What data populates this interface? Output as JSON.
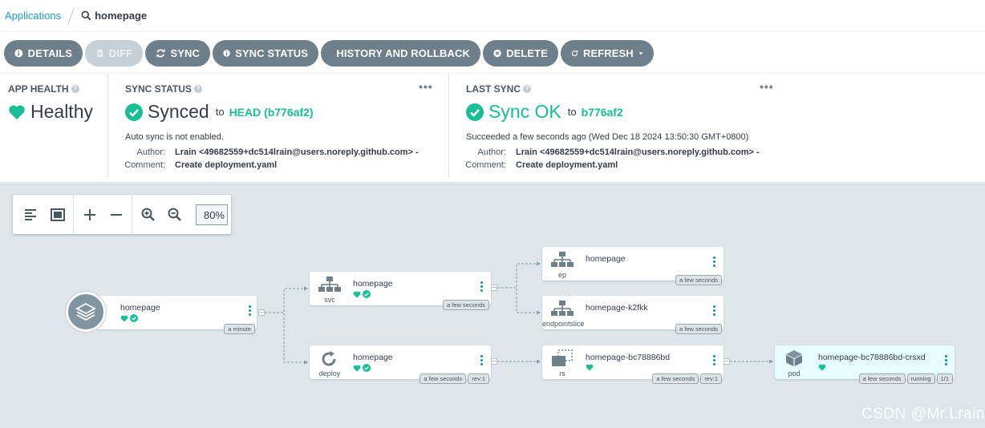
{
  "breadcrumb": {
    "root": "Applications",
    "current": "homepage"
  },
  "toolbar": {
    "details": "DETAILS",
    "diff": "DIFF",
    "sync": "SYNC",
    "sync_status": "SYNC STATUS",
    "history": "HISTORY AND ROLLBACK",
    "delete": "DELETE",
    "refresh": "REFRESH"
  },
  "app_health": {
    "title": "APP HEALTH",
    "value": "Healthy"
  },
  "sync_status": {
    "title": "SYNC STATUS",
    "value": "Synced",
    "to_label": "to",
    "revision": "HEAD (b776af2)",
    "note": "Auto sync is not enabled.",
    "author_label": "Author:",
    "author": "Lrain <49682559+dc514lrain@users.noreply.github.com> -",
    "comment_label": "Comment:",
    "comment": "Create deployment.yaml"
  },
  "last_sync": {
    "title": "LAST SYNC",
    "value": "Sync OK",
    "to_label": "to",
    "revision": "b776af2",
    "note": "Succeeded a few seconds ago (Wed Dec 18 2024 13:50:30 GMT+0800)",
    "author_label": "Author:",
    "author": "Lrain <49682559+dc514lrain@users.noreply.github.com> -",
    "comment_label": "Comment:",
    "comment": "Create deployment.yaml"
  },
  "graph_tools": {
    "zoom": "80%"
  },
  "nodes": {
    "app": {
      "name": "homepage",
      "tags": [
        "a minute"
      ]
    },
    "svc": {
      "name": "homepage",
      "kind": "svc",
      "tags": [
        "a few seconds"
      ]
    },
    "deploy": {
      "name": "homepage",
      "kind": "deploy",
      "tags": [
        "a few seconds",
        "rev:1"
      ]
    },
    "ep": {
      "name": "homepage",
      "kind": "ep",
      "tags": [
        "a few seconds"
      ]
    },
    "endpointslice": {
      "name": "homepage-k2fkk",
      "kind": "endpointslice",
      "tags": [
        "a few seconds"
      ]
    },
    "rs": {
      "name": "homepage-bc78886bd",
      "kind": "rs",
      "tags": [
        "a few seconds",
        "rev:1"
      ]
    },
    "pod": {
      "name": "homepage-bc78886bd-crsxd",
      "kind": "pod",
      "tags": [
        "a few seconds",
        "running",
        "1/1"
      ]
    }
  },
  "watermark": "CSDN @Mr.Lrain",
  "colors": {
    "accent": "#18be94",
    "button": "#6d7f8b",
    "link": "#1b9bd8",
    "canvas": "#dee6eb"
  }
}
